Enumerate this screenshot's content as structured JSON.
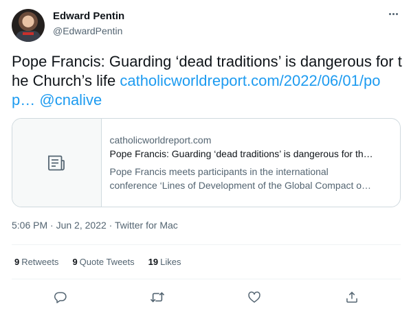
{
  "author": {
    "display_name": "Edward Pentin",
    "handle": "@EdwardPentin",
    "avatar": "avatar-photo"
  },
  "tweet": {
    "text_before_link": "Pope Francis: Guarding ‘dead traditions’ is dangerous for the Church’s life ",
    "link_text": "catholicworldreport.com/2022/06/01/pop…",
    "space": " ",
    "mention": "@cnalive"
  },
  "card": {
    "thumbnail_icon": "article-icon",
    "domain": "catholicworldreport.com",
    "title": "Pope Francis: Guarding ‘dead traditions’ is dangerous for th…",
    "description_line1": "Pope Francis meets participants in the international",
    "description_line2": "conference ‘Lines of Development of the Global Compact o…"
  },
  "meta": {
    "time": "5:06 PM",
    "date": "Jun 2, 2022",
    "source": "Twitter for Mac",
    "separator": " · "
  },
  "stats": {
    "retweets_count": "9",
    "retweets_label": "Retweets",
    "quotes_count": "9",
    "quotes_label": "Quote Tweets",
    "likes_count": "19",
    "likes_label": "Likes"
  },
  "actions": {
    "reply_icon": "reply-icon",
    "retweet_icon": "retweet-icon",
    "like_icon": "heart-icon",
    "share_icon": "share-icon"
  },
  "colors": {
    "link": "#1d9bf0",
    "text": "#0f1419",
    "secondary": "#536471",
    "border": "#cfd9de"
  }
}
